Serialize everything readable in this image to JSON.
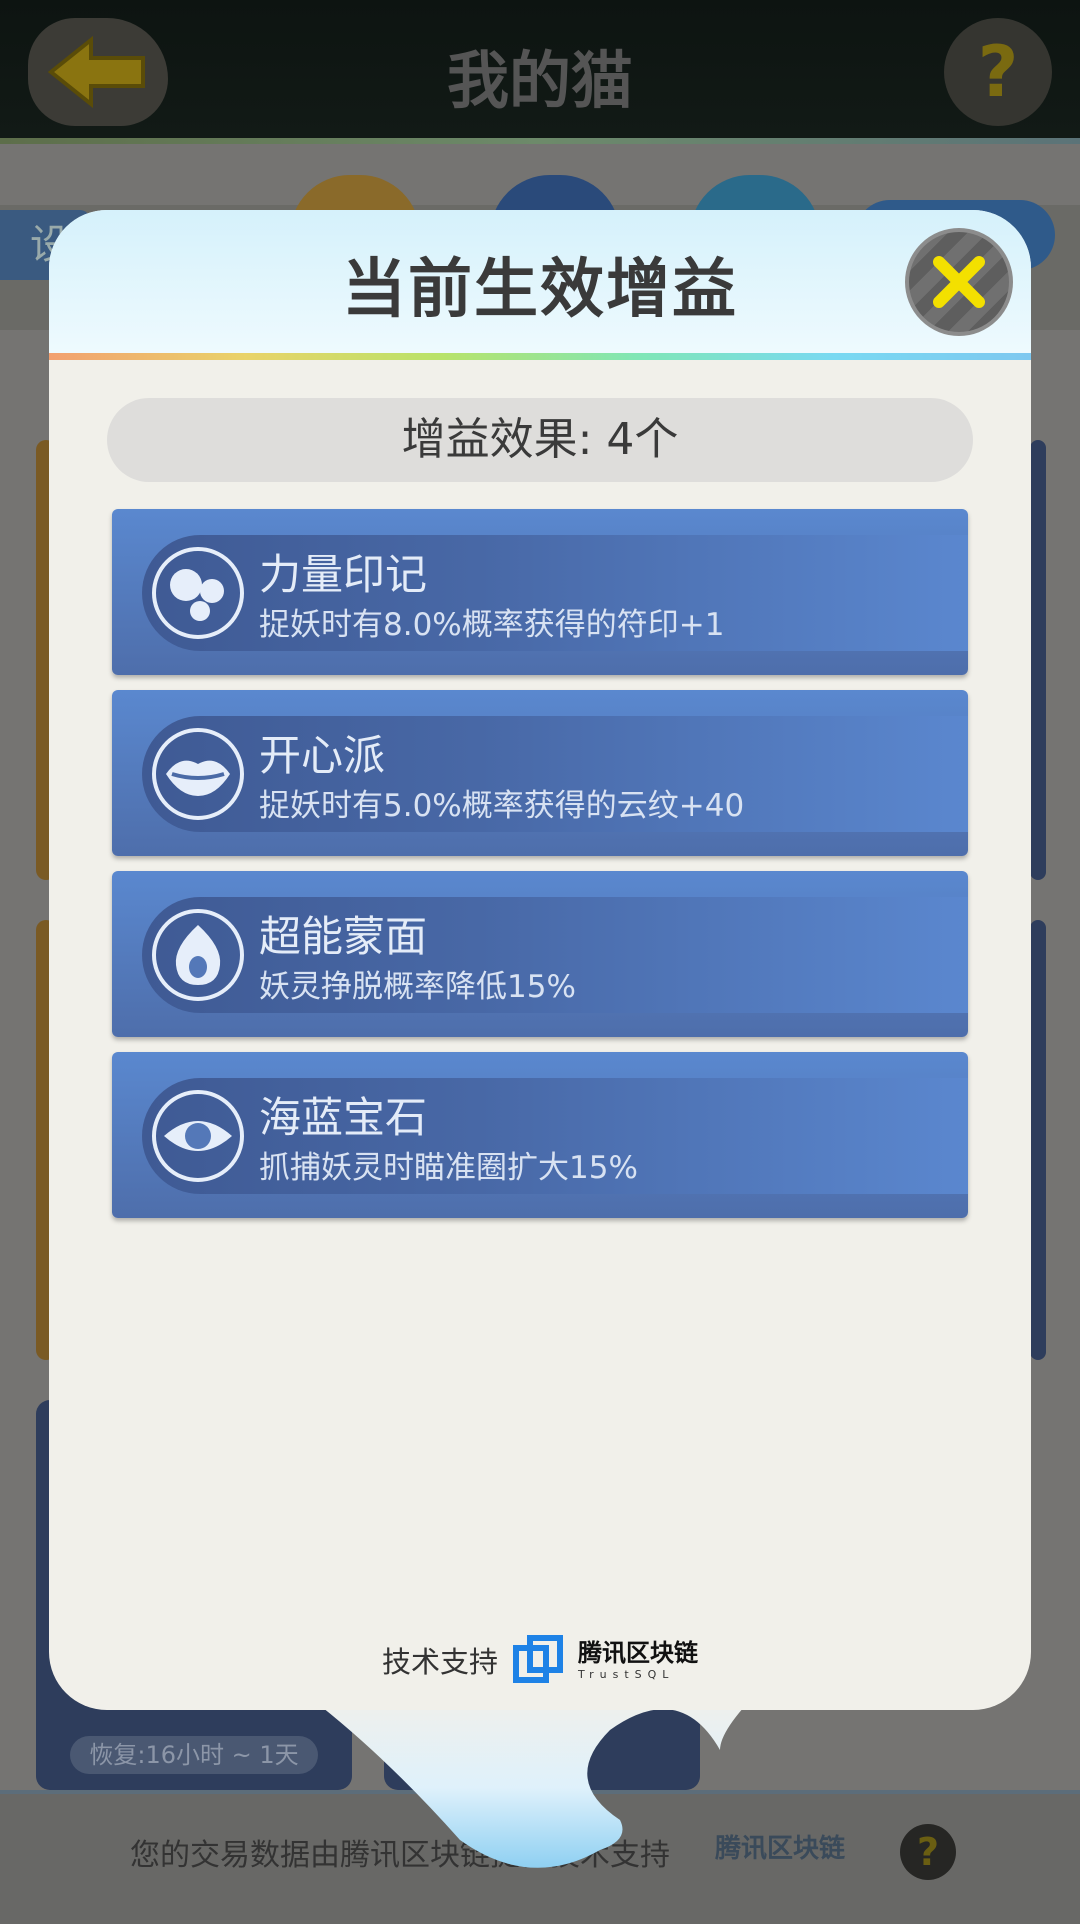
{
  "header": {
    "title": "我的猫",
    "back_label": "back",
    "help_label": "?"
  },
  "background": {
    "tab_left_label": "设",
    "card_footer_text": "恢复:16小时 ~ 1天",
    "bottom_text": "您的交易数据由腾讯区块链提供技术支持",
    "bottom_logo_text": "腾讯区块链",
    "bottom_help_label": "?"
  },
  "modal": {
    "title": "当前生效增益",
    "close_label": "close",
    "count_text": "增益效果: 4个",
    "buffs": [
      {
        "name": "力量印记",
        "desc": "捉妖时有8.0%概率获得的符印+1",
        "icon": "bubbles-icon"
      },
      {
        "name": "开心派",
        "desc": "捉妖时有5.0%概率获得的云纹+40",
        "icon": "lips-icon"
      },
      {
        "name": "超能蒙面",
        "desc": "妖灵挣脱概率降低15%",
        "icon": "egg-icon"
      },
      {
        "name": "海蓝宝石",
        "desc": "抓捕妖灵时瞄准圈扩大15%",
        "icon": "eye-icon"
      }
    ],
    "support": {
      "label": "技术支持",
      "logo_cn": "腾讯区块链",
      "logo_en": "TrustSQL"
    }
  },
  "colors": {
    "buff_card": "#5a88cf",
    "close_x": "#f3e000",
    "back_arrow": "#c9a400",
    "logo_blue": "#1e82e6"
  }
}
